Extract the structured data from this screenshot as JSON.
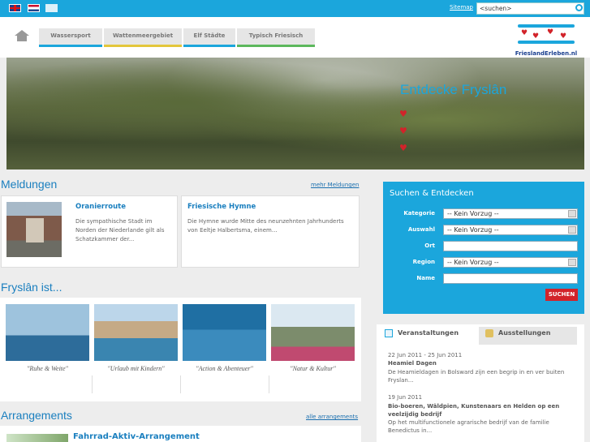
{
  "topbar": {
    "languages": [
      "English",
      "Nederlands",
      "Français"
    ],
    "sitemap_label": "Sitemap",
    "search_value": "<suchen>"
  },
  "nav": {
    "tabs": [
      {
        "label": "Wassersport",
        "color": "#1ba6dc"
      },
      {
        "label": "Wattenmeergebiet",
        "color": "#e3c63b"
      },
      {
        "label": "Elf Städte",
        "color": "#1ba6dc"
      },
      {
        "label": "Typisch Friesisch",
        "color": "#5cb85c"
      }
    ],
    "logo_text": "FrieslandErleben.nl"
  },
  "hero": {
    "title": "Entdecke Fryslân"
  },
  "meldungen": {
    "title": "Meldungen",
    "more_label": "mehr Meldungen",
    "items": [
      {
        "title": "Oranierroute",
        "text": "Die sympathische Stadt im Norden der Niederlande gilt als Schatzkammer der..."
      },
      {
        "title": "Friesische Hymne",
        "text": "Die Hymne wurde Mitte des neunzehnten Jahrhunderts von Eeltje Halbertsma, einem..."
      }
    ]
  },
  "fryslan": {
    "title": "Fryslân ist...",
    "items": [
      {
        "caption": "\"Ruhe & Weite\""
      },
      {
        "caption": "\"Urlaub mit Kindern\""
      },
      {
        "caption": "\"Action & Abenteuer\""
      },
      {
        "caption": "\"Natur & Kultur\""
      }
    ]
  },
  "arrangements": {
    "title": "Arrangements",
    "more_label": "alle arrangements",
    "first_title": "Fahrrad-Aktiv-Arrangement"
  },
  "search_panel": {
    "title": "Suchen & Entdecken",
    "fields": {
      "kategorie_label": "Kategorie",
      "kategorie_value": "-- Kein Vorzug --",
      "auswahl_label": "Auswahl",
      "auswahl_value": "-- Kein Vorzug --",
      "ort_label": "Ort",
      "region_label": "Region",
      "region_value": "-- Kein Vorzug --",
      "name_label": "Name"
    },
    "button_label": "SUCHEN"
  },
  "events": {
    "tabs": [
      "Veranstaltungen",
      "Ausstellungen"
    ],
    "items": [
      {
        "date": "22 Jun 2011 - 25 Jun 2011",
        "title": "Heamiel Dagen",
        "text": "De Heamieldagen in Bolsward zijn een begrip in en ver buiten Fryslan..."
      },
      {
        "date": "19 Jun 2011",
        "title": "Bio-boeren, Wäldpien, Kunstenaars en Helden op een veelzijdig bedrijf",
        "text": "Op het multifunctionele agrarische bedrijf van de familie Benedictus in..."
      }
    ]
  },
  "colors": {
    "brand_blue": "#1ba6dc",
    "accent_red": "#d2232a"
  }
}
